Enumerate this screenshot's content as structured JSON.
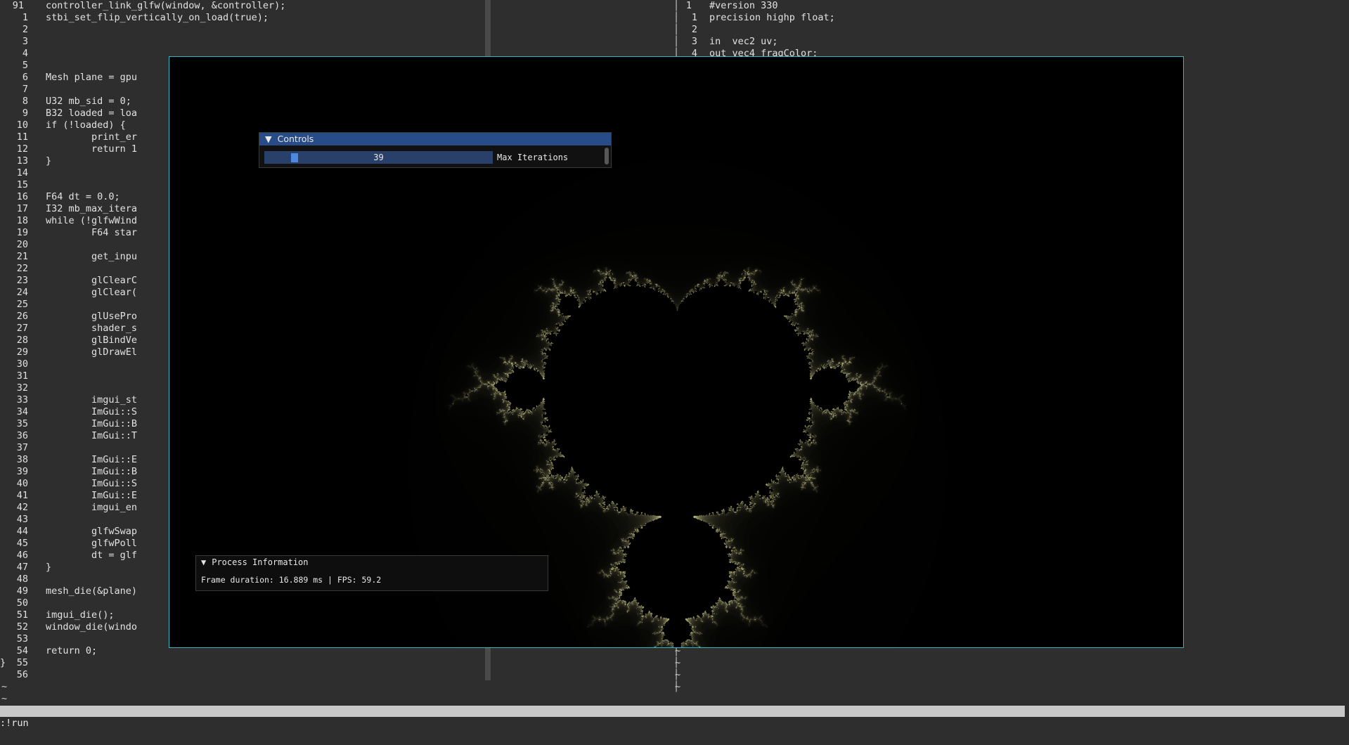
{
  "left_pane": {
    "lines": [
      {
        "num": "91",
        "text": "        controller_link_glfw(window, &controller);"
      },
      {
        "num": "1",
        "text": "        stbi_set_flip_vertically_on_load(true);"
      },
      {
        "num": "2",
        "text": ""
      },
      {
        "num": "3",
        "text": ""
      },
      {
        "num": "4",
        "text": ""
      },
      {
        "num": "5",
        "text": ""
      },
      {
        "num": "6",
        "text": "        Mesh plane = gpu"
      },
      {
        "num": "7",
        "text": ""
      },
      {
        "num": "8",
        "text": "        U32 mb_sid = 0;"
      },
      {
        "num": "9",
        "text": "        B32 loaded = loa"
      },
      {
        "num": "10",
        "text": "        if (!loaded) {"
      },
      {
        "num": "11",
        "text": "                print_er"
      },
      {
        "num": "12",
        "text": "                return 1"
      },
      {
        "num": "13",
        "text": "        }"
      },
      {
        "num": "14",
        "text": ""
      },
      {
        "num": "15",
        "text": ""
      },
      {
        "num": "16",
        "text": "        F64 dt = 0.0;"
      },
      {
        "num": "17",
        "text": "        I32 mb_max_itera"
      },
      {
        "num": "18",
        "text": "        while (!glfwWind"
      },
      {
        "num": "19",
        "text": "                F64 star"
      },
      {
        "num": "20",
        "text": ""
      },
      {
        "num": "21",
        "text": "                get_inpu"
      },
      {
        "num": "22",
        "text": ""
      },
      {
        "num": "23",
        "text": "                glClearC"
      },
      {
        "num": "24",
        "text": "                glClear("
      },
      {
        "num": "25",
        "text": ""
      },
      {
        "num": "26",
        "text": "                glUsePro"
      },
      {
        "num": "27",
        "text": "                shader_s"
      },
      {
        "num": "28",
        "text": "                glBindVe"
      },
      {
        "num": "29",
        "text": "                glDrawEl"
      },
      {
        "num": "30",
        "text": ""
      },
      {
        "num": "31",
        "text": ""
      },
      {
        "num": "32",
        "text": ""
      },
      {
        "num": "33",
        "text": "                imgui_st"
      },
      {
        "num": "34",
        "text": "                ImGui::S"
      },
      {
        "num": "35",
        "text": "                ImGui::B"
      },
      {
        "num": "36",
        "text": "                ImGui::T"
      },
      {
        "num": "37",
        "text": ""
      },
      {
        "num": "38",
        "text": "                ImGui::E"
      },
      {
        "num": "39",
        "text": "                ImGui::B"
      },
      {
        "num": "40",
        "text": "                ImGui::S"
      },
      {
        "num": "41",
        "text": "                ImGui::E"
      },
      {
        "num": "42",
        "text": "                imgui_en"
      },
      {
        "num": "43",
        "text": ""
      },
      {
        "num": "44",
        "text": "                glfwSwap"
      },
      {
        "num": "45",
        "text": "                glfwPoll"
      },
      {
        "num": "46",
        "text": "                dt = glf"
      },
      {
        "num": "47",
        "text": "        }"
      },
      {
        "num": "48",
        "text": ""
      },
      {
        "num": "49",
        "text": "        mesh_die(&plane)"
      },
      {
        "num": "50",
        "text": ""
      },
      {
        "num": "51",
        "text": "        imgui_die();"
      },
      {
        "num": "52",
        "text": "        window_die(windo"
      },
      {
        "num": "53",
        "text": ""
      },
      {
        "num": "54",
        "text": "        return 0;"
      },
      {
        "num": "55",
        "text": "}"
      },
      {
        "num": "56",
        "text": ""
      }
    ],
    "tildes": [
      "~",
      "~"
    ]
  },
  "right_pane": {
    "lines": [
      {
        "num": "1",
        "text": "#version 330"
      },
      {
        "num": "1",
        "text": "precision highp float;"
      },
      {
        "num": "2",
        "text": ""
      },
      {
        "num": "3",
        "text": "in  vec2 uv;"
      },
      {
        "num": "4",
        "text": "out vec4 fragColor;"
      }
    ],
    "tildes": [
      "~",
      "~",
      "~",
      "~",
      "~"
    ]
  },
  "separator_char": "│",
  "command_line": ":!run",
  "controls_window": {
    "title": "Controls",
    "collapse_glyph": "▼",
    "slider_value": "39",
    "slider_label": "Max Iterations",
    "slider_fraction": 0.06
  },
  "process_window": {
    "title": "Process Information",
    "collapse_glyph": "▼",
    "text": "Frame duration: 16.889 ms | FPS: 59.2"
  },
  "colors": {
    "editor_bg": "#2e2e2e",
    "window_border": "#2fb6c2",
    "imgui_title_active": "#284c87",
    "slider_bg": "#29406a",
    "slider_grab": "#4d88e0",
    "fractal_glow": "#e8e6a0"
  }
}
